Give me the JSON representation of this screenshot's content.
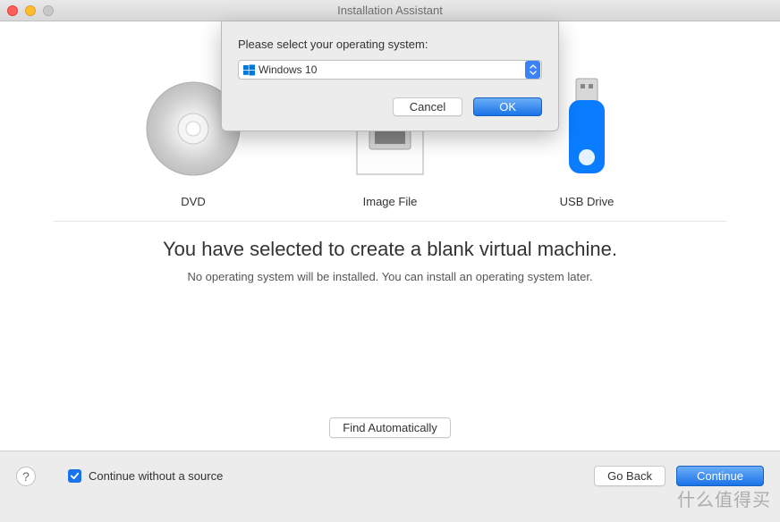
{
  "window": {
    "title": "Installation Assistant"
  },
  "sheet": {
    "prompt": "Please select your operating system:",
    "selected_os": "Windows 10",
    "cancel_label": "Cancel",
    "ok_label": "OK"
  },
  "sources": {
    "dvd_label": "DVD",
    "image_label": "Image File",
    "usb_label": "USB Drive"
  },
  "message": {
    "headline": "You have selected to create a blank virtual machine.",
    "subtext": "No operating system will be installed. You can install an operating system later."
  },
  "find_auto_label": "Find Automatically",
  "footer": {
    "continue_without_source_label": "Continue without a source",
    "continue_checked": true,
    "go_back_label": "Go Back",
    "continue_label": "Continue"
  },
  "watermark": "什么值得买"
}
